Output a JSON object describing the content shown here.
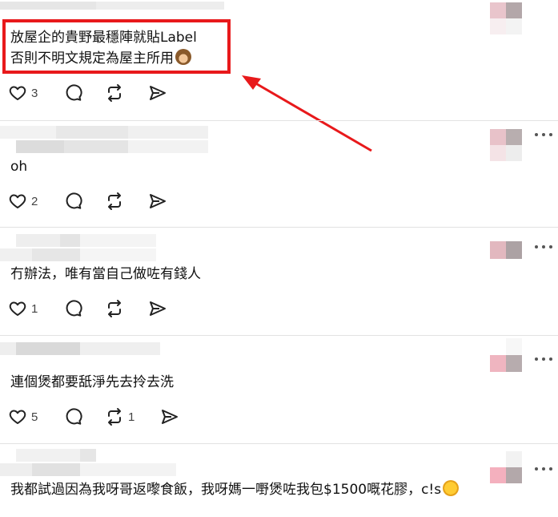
{
  "comments": [
    {
      "text_lines": [
        "放屋企的貴野最穩陣就貼Label",
        "否則不明文規定為屋主所用"
      ],
      "emoji": "see-no-evil-monkey",
      "like_count": "3",
      "repost_count": ""
    },
    {
      "text_lines": [
        "oh"
      ],
      "like_count": "2",
      "repost_count": ""
    },
    {
      "text_lines": [
        "冇辦法，唯有當自己做咗有錢人"
      ],
      "like_count": "1",
      "repost_count": ""
    },
    {
      "text_lines": [
        "連個煲都要舐淨先去拎去洗"
      ],
      "like_count": "5",
      "repost_count": "1"
    },
    {
      "text_lines": [
        "我都試過因為我呀哥返嚟食飯，我呀媽一嘢煲咗我包$1500嘅花膠，c!s"
      ],
      "emoji": "crying-face",
      "like_count": "",
      "repost_count": ""
    }
  ],
  "icons": {
    "like": "heart-icon",
    "reply": "comment-bubble-icon",
    "repost": "repost-icon",
    "share": "send-icon",
    "more": "more-dots-icon"
  },
  "colors": {
    "annotation": "#e8191b",
    "divider": "#e2e2e2",
    "icon": "#222222"
  }
}
